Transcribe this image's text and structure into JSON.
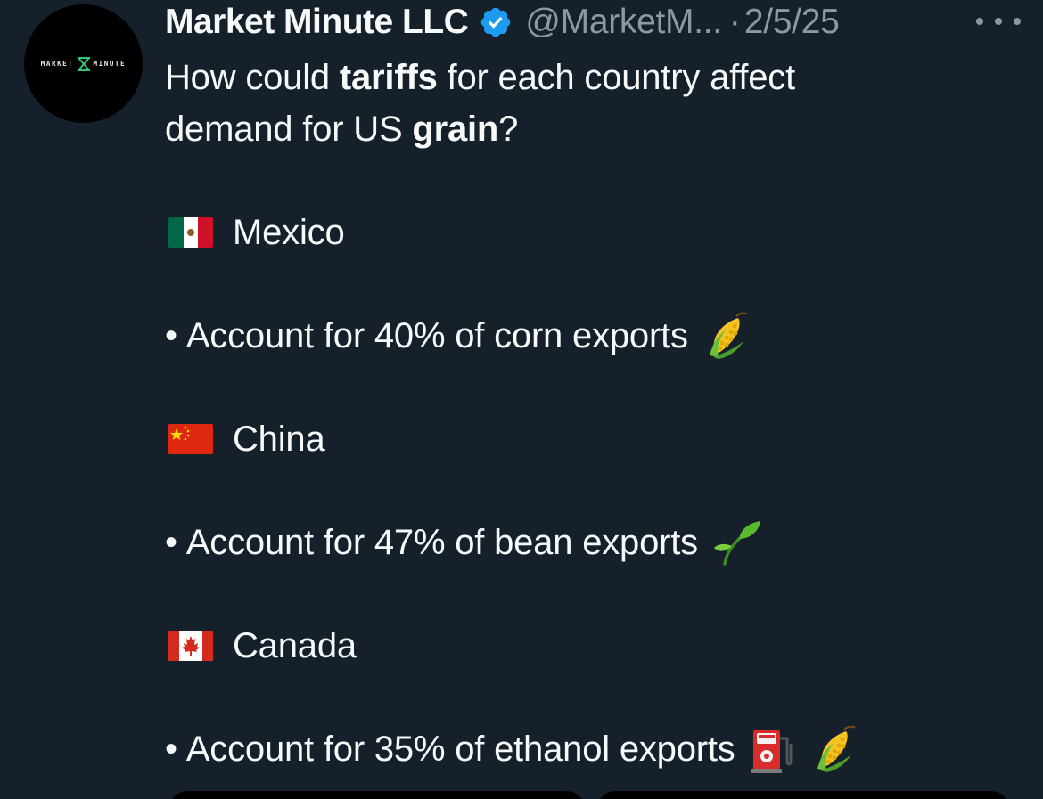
{
  "author": {
    "name": "Market Minute LLC",
    "handle": "@MarketM...",
    "separator": "·",
    "date": "2/5/25",
    "avatar_text_left": "MARKET",
    "avatar_text_right": "MINUTE",
    "verified_color": "#1d9bf0"
  },
  "tweet": {
    "intro_1": "How could ",
    "intro_bold_1": "tariffs",
    "intro_2": " for each country affect",
    "intro_3": "demand for US ",
    "intro_bold_2": "grain",
    "intro_4": "?",
    "sections": [
      {
        "flag": "mexico-flag-icon",
        "country": "Mexico",
        "bullet": "•",
        "detail": "Account for 40% of corn exports",
        "emojis": [
          "corn-icon"
        ]
      },
      {
        "flag": "china-flag-icon",
        "country": "China",
        "bullet": "•",
        "detail": "Account for 47% of bean exports",
        "emojis": [
          "seedling-icon"
        ]
      },
      {
        "flag": "canada-flag-icon",
        "country": "Canada",
        "bullet": "•",
        "detail": "Account for 35% of ethanol exports",
        "emojis": [
          "fuel-pump-icon",
          "corn-icon"
        ]
      }
    ]
  },
  "colors": {
    "background": "#15202b",
    "text": "#f7f9f9",
    "muted": "#8b98a5"
  }
}
